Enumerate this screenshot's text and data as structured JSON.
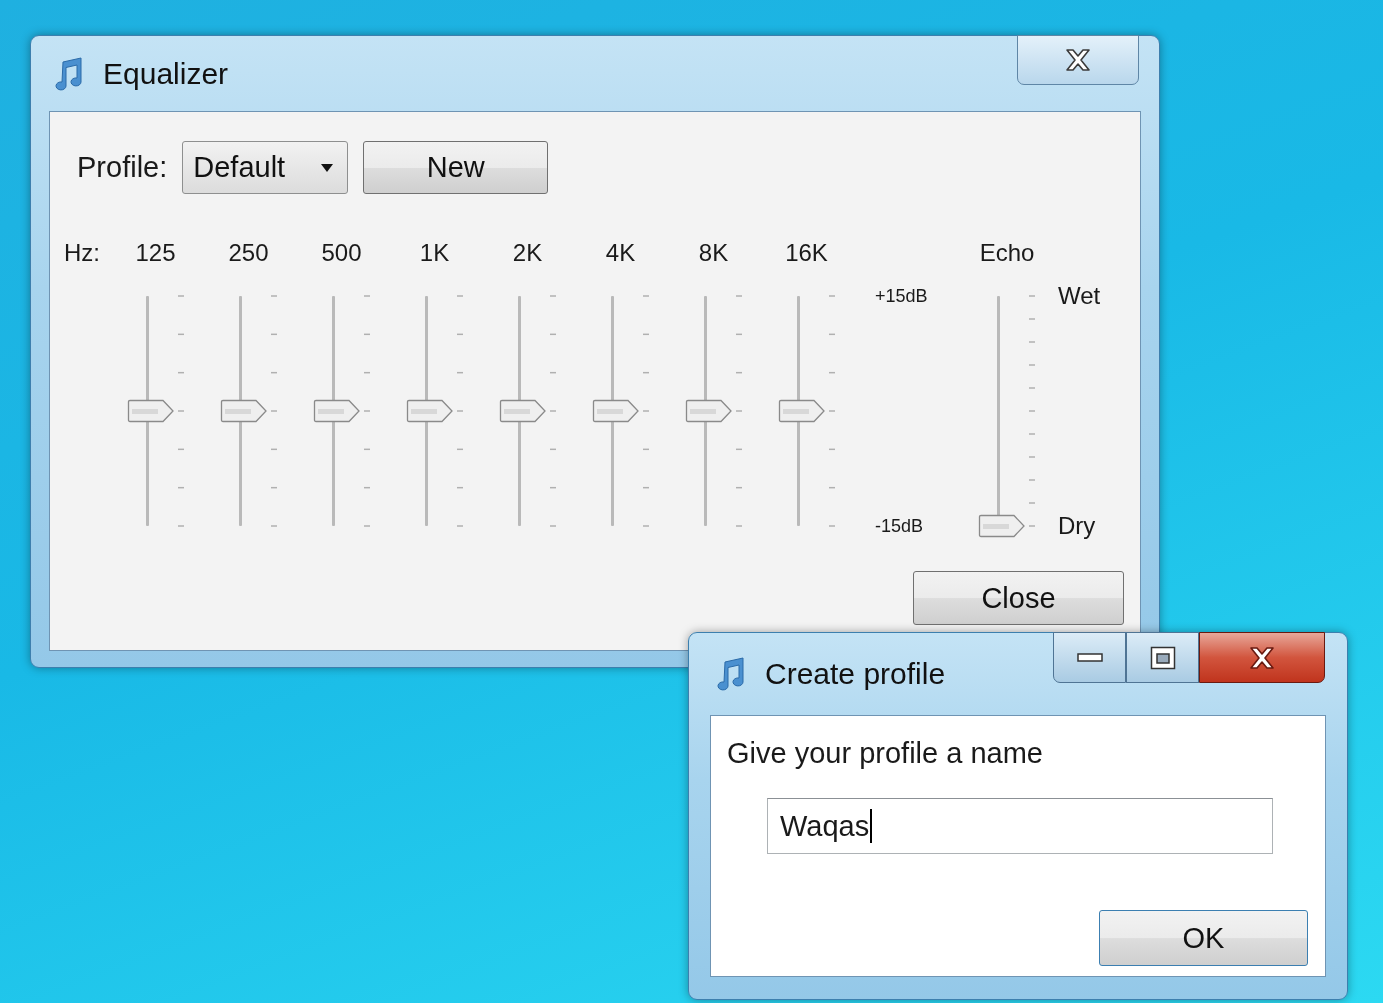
{
  "equalizer": {
    "title": "Equalizer",
    "profile": {
      "label": "Profile:",
      "value": "Default"
    },
    "new_button": "New",
    "hz_label": "Hz:",
    "bands": [
      {
        "label": "125",
        "level": 0.5
      },
      {
        "label": "250",
        "level": 0.5
      },
      {
        "label": "500",
        "level": 0.5
      },
      {
        "label": "1K",
        "level": 0.5
      },
      {
        "label": "2K",
        "level": 0.5
      },
      {
        "label": "4K",
        "level": 0.5
      },
      {
        "label": "8K",
        "level": 0.5
      },
      {
        "label": "16K",
        "level": 0.5
      }
    ],
    "scale": {
      "top": "+15dB",
      "bottom": "-15dB"
    },
    "echo": {
      "label": "Echo",
      "top": "Wet",
      "bottom": "Dry",
      "level": 0
    },
    "close_button": "Close"
  },
  "create_profile": {
    "title": "Create profile",
    "prompt": "Give your profile a name",
    "input": {
      "value": "Waqas",
      "focused": true
    },
    "ok_button": "OK"
  }
}
